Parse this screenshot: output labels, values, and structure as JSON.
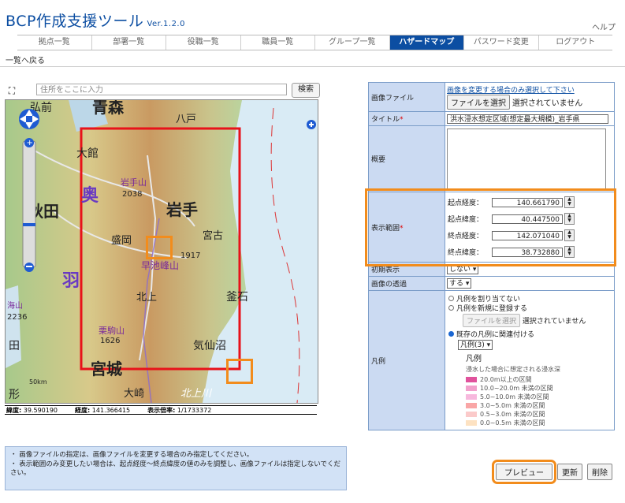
{
  "header": {
    "title": "BCP作成支援ツール",
    "version": "Ver.1.2.0",
    "help": "ヘルプ"
  },
  "nav": [
    {
      "label": "拠点一覧",
      "active": false
    },
    {
      "label": "部署一覧",
      "active": false
    },
    {
      "label": "役職一覧",
      "active": false
    },
    {
      "label": "職員一覧",
      "active": false
    },
    {
      "label": "グループ一覧",
      "active": false
    },
    {
      "label": "ハザードマップ",
      "active": true
    },
    {
      "label": "パスワード変更",
      "active": false
    },
    {
      "label": "ログアウト",
      "active": false
    }
  ],
  "back_link": "一覧へ戻る",
  "map": {
    "search_placeholder": "住所をここに入力",
    "search_button": "検索",
    "labels": {
      "aomori": "青森",
      "hachinohe": "八戸",
      "hirosaki": "弘前",
      "odate": "大館",
      "iwate_san": "岩手山",
      "iwate_elev": "2038",
      "iwate": "岩手",
      "akita": "秋田",
      "morioka": "盛岡",
      "miyako": "宮古",
      "hayachine_elev": "1917",
      "hayachine": "早池峰山",
      "kitakami": "北上",
      "kamaishi": "釜石",
      "kurikoma": "栗駒山",
      "kurikoma_elev": "1626",
      "kesennuma": "気仙沼",
      "miyagi": "宮城",
      "osaki": "大崎",
      "kitakamigawa": "北上川",
      "ou": "奥",
      "u": "羽",
      "umi": "海山",
      "elev2236": "2236",
      "den": "田",
      "kata": "形",
      "scale": "50km"
    },
    "coords": {
      "lat_label": "緯度:",
      "lat": "39.590190",
      "lon_label": "経度:",
      "lon": "141.366415",
      "scale_label": "表示倍率:",
      "scale": "1/1733372"
    }
  },
  "notes": [
    "画像ファイルの指定は、画像ファイルを変更する場合のみ指定してください。",
    "表示範囲のみ変更したい場合は、起点経度～終点緯度の値のみを調整し、画像ファイルは指定しないでください。"
  ],
  "form": {
    "image_label": "画像ファイル",
    "image_hint": "画像を変更する場合のみ選択して下さい",
    "file_button": "ファイルを選択",
    "file_status": "選択されていません",
    "title_label": "タイトル",
    "title_value": "洪水浸水想定区域(想定最大規模)_岩手県",
    "summary_label": "概要",
    "range_label": "表示範囲",
    "range": [
      {
        "label": "起点経度：",
        "value": "140.661790"
      },
      {
        "label": "起点緯度：",
        "value": "40.447500"
      },
      {
        "label": "終点経度：",
        "value": "142.071040"
      },
      {
        "label": "終点緯度：",
        "value": "38.732880"
      }
    ],
    "initial_label": "初期表示",
    "initial_value": "しない",
    "transp_label": "画像の透過",
    "transp_value": "する",
    "legend_label": "凡例",
    "legend_opt1": "凡例を割り当てない",
    "legend_opt2": "凡例を新規に登録する",
    "legend_file_button": "ファイルを選択",
    "legend_file_status": "選択されていません",
    "legend_opt3": "既存の凡例に関連付ける",
    "legend_select": "凡例(3)",
    "legend_title": "凡例",
    "legend_subtitle": "浸水した場合に想定される浸水深",
    "legend_items": [
      {
        "label": "20.0m以上の区間",
        "color": "#e0529c"
      },
      {
        "label": "10.0~20.0m 未満の区間",
        "color": "#f2a0cc"
      },
      {
        "label": "5.0~10.0m 未満の区間",
        "color": "#f7b8dd"
      },
      {
        "label": "3.0~5.0m 未満の区間",
        "color": "#f9a6a6"
      },
      {
        "label": "0.5~3.0m 未満の区間",
        "color": "#fbcaca"
      },
      {
        "label": "0.0~0.5m 未満の区間",
        "color": "#fde2c2"
      }
    ]
  },
  "actions": {
    "preview": "プレビュー",
    "update": "更新",
    "delete": "削除"
  }
}
